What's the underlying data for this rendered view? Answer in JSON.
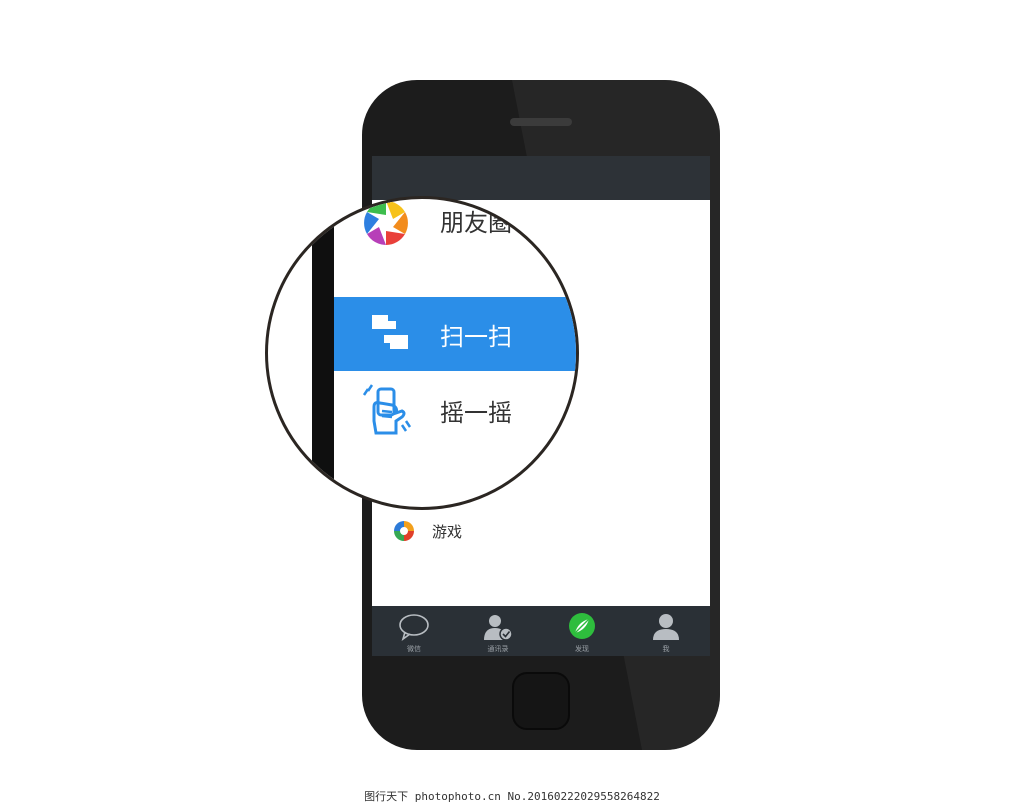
{
  "app_screen": {
    "list": {
      "moments_label": "朋友圈",
      "scan_label": "扫一扫",
      "shake_label": "摇一摇",
      "games_label": "游戏"
    },
    "tabbar": {
      "tabs": [
        {
          "label": "微信",
          "icon": "chat-bubble-icon"
        },
        {
          "label": "通讯录",
          "icon": "contacts-icon"
        },
        {
          "label": "发现",
          "icon": "discover-compass-icon"
        },
        {
          "label": "我",
          "icon": "profile-icon"
        }
      ]
    },
    "colors": {
      "highlight": "#2b8ee8",
      "discover_active": "#2ebd3d",
      "tab_bar": "#2a3036"
    }
  },
  "watermark": {
    "text": "图行天下 photophoto.cn No.20160222029558264822"
  }
}
